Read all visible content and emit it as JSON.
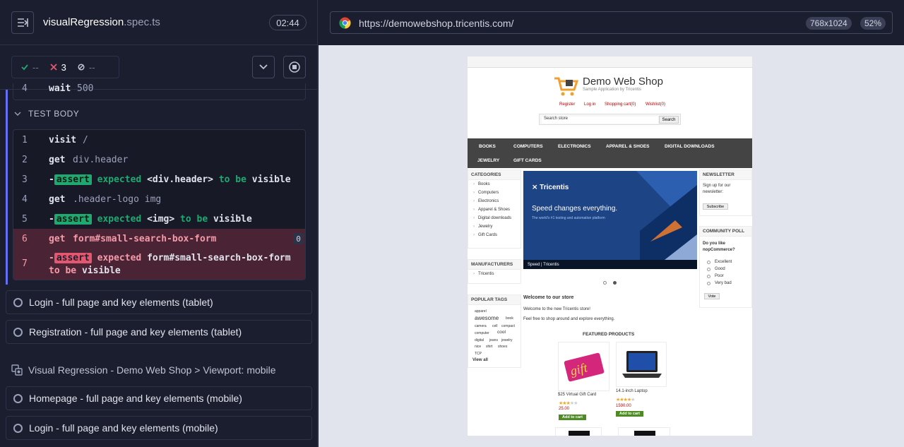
{
  "header": {
    "spec_name": "visualRegression",
    "spec_ext": ".spec.ts",
    "timer": "02:44"
  },
  "stats": {
    "passed": "--",
    "failed": "3",
    "pending": "--"
  },
  "hook": {
    "line": "4",
    "command": "wait",
    "arg": "500"
  },
  "test_body": {
    "label": "TEST BODY",
    "commands": [
      {
        "n": "1",
        "cmd": "visit",
        "msg": "/"
      },
      {
        "n": "2",
        "cmd": "get",
        "msg": "div.header"
      },
      {
        "n": "3",
        "assert": "assert",
        "text1": "expected",
        "subj": "<div.header>",
        "text2": "to be",
        "val": "visible"
      },
      {
        "n": "4",
        "cmd": "get",
        "msg": ".header-logo img"
      },
      {
        "n": "5",
        "assert": "assert",
        "text1": "expected",
        "subj": "<img>",
        "text2": "to be",
        "val": "visible"
      },
      {
        "n": "6",
        "cmd": "get",
        "msg": "form#small-search-box-form",
        "count": "0"
      },
      {
        "n": "7",
        "assert": "assert",
        "text1": "expected",
        "subj": "form#small-search-box-form",
        "text2": "to",
        "text3": "be",
        "val": "visible"
      }
    ]
  },
  "tests_tablet": [
    "Login - full page and key elements (tablet)",
    "Registration - full page and key elements (tablet)"
  ],
  "suite_mobile": "Visual Regression - Demo Web Shop > Viewport: mobile",
  "tests_mobile": [
    "Homepage - full page and key elements (mobile)",
    "Login - full page and key elements (mobile)"
  ],
  "browser": {
    "url": "https://demowebshop.tricentis.com/",
    "viewport": "768x1024",
    "zoom": "52%"
  },
  "aut": {
    "logo_title": "Demo Web Shop",
    "logo_sub": "Sample Application by Tricentis",
    "links": [
      "Register",
      "Log in",
      "Shopping cart(0)",
      "Wishlist(0)"
    ],
    "search_placeholder": "Search store",
    "search_btn": "Search",
    "nav": [
      "BOOKS",
      "COMPUTERS",
      "ELECTRONICS",
      "APPAREL & SHOES",
      "DIGITAL DOWNLOADS",
      "JEWELRY",
      "GIFT CARDS"
    ],
    "categories_title": "CATEGORIES",
    "categories": [
      "Books",
      "Computers",
      "Electronics",
      "Apparel & Shoes",
      "Digital downloads",
      "Jewelry",
      "Gift Cards"
    ],
    "manufacturers_title": "MANUFACTURERS",
    "manufacturers": [
      "Tricentis"
    ],
    "tags_title": "POPULAR TAGS",
    "tags": [
      "apparel",
      "awesome",
      "book",
      "camera",
      "cell",
      "compact",
      "computer",
      "cool",
      "digital",
      "jeans",
      "jewelry",
      "nice",
      "shirt",
      "shoes",
      "TCP"
    ],
    "view_all": "View all",
    "slider_logo": "Tricentis",
    "slider_headline": "Speed changes everything.",
    "slider_sub": "The world's #1 testing and automation platform",
    "slider_caption": "Speed | Tricentis",
    "newsletter_title": "NEWSLETTER",
    "newsletter_text": "Sign up for our newsletter:",
    "subscribe": "Subscribe",
    "poll_title": "COMMUNITY POLL",
    "poll_question": "Do you like nopCommerce?",
    "poll_options": [
      "Excellent",
      "Good",
      "Poor",
      "Very bad"
    ],
    "vote": "Vote",
    "welcome_title": "Welcome to our store",
    "welcome_p1": "Welcome to the new Tricentis store!",
    "welcome_p2": "Feel free to shop around and explore everything.",
    "featured": "FEATURED PRODUCTS",
    "products": [
      {
        "name": "$25 Virtual Gift Card",
        "price": "25.00",
        "rating": 3
      },
      {
        "name": "14.1-inch Laptop",
        "price": "1590.00",
        "rating": 4
      }
    ],
    "add_to_cart": "Add to cart",
    "gift_word": "gift"
  },
  "colors": {
    "accent": "#6470f3",
    "pass": "#1fa971",
    "fail": "#e45770"
  }
}
